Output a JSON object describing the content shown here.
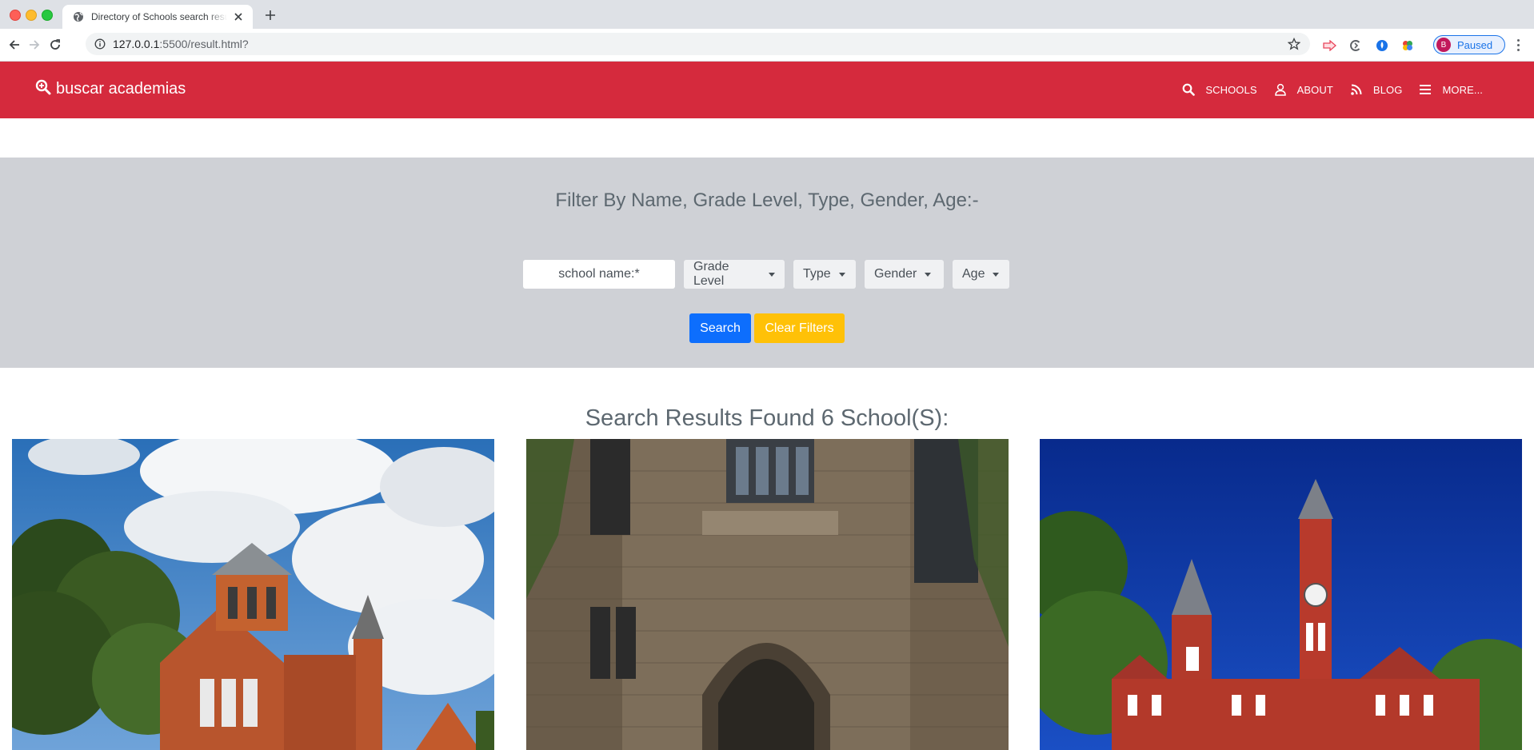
{
  "browser": {
    "tab_title": "Directory of Schools search results",
    "url_host": "127.0.0.1",
    "url_rest": ":5500/result.html?",
    "profile_initial": "B",
    "profile_label": "Paused"
  },
  "navbar": {
    "brand": "buscar academias",
    "color": "#d52a3d",
    "links": [
      {
        "icon": "search-icon",
        "label": "SCHOOLS"
      },
      {
        "icon": "user-icon",
        "label": "ABOUT"
      },
      {
        "icon": "rss-icon",
        "label": "BLOG"
      },
      {
        "icon": "menu-icon",
        "label": "MORE..."
      }
    ]
  },
  "filters": {
    "heading": "Filter By Name, Grade Level, Type, Gender, Age:-",
    "name_placeholder": "school name:*",
    "dropdowns": [
      "Grade Level",
      "Type",
      "Gender",
      "Age"
    ],
    "search_label": "Search",
    "clear_label": "Clear Filters"
  },
  "results": {
    "heading": "Search Results Found 6 School(S):",
    "cards": [
      {
        "image": "red-brick-church-under-cloudy-sky"
      },
      {
        "image": "stone-gothic-archway"
      },
      {
        "image": "red-brick-clock-tower"
      }
    ]
  }
}
